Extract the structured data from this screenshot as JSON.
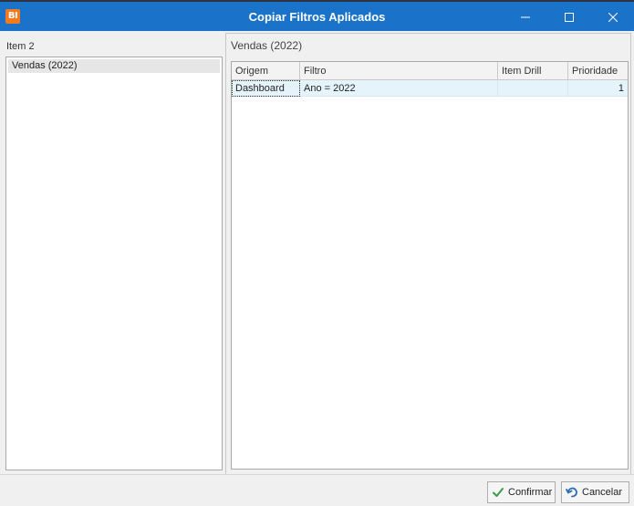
{
  "window": {
    "app_icon_text": "BI",
    "title": "Copiar Filtros Aplicados"
  },
  "left": {
    "label": "Item 2",
    "items": [
      {
        "label": "Vendas (2022)",
        "selected": true
      }
    ]
  },
  "right": {
    "title": "Vendas (2022)",
    "grid": {
      "columns": [
        "Origem",
        "Filtro",
        "Item Drill",
        "Prioridade"
      ],
      "rows": [
        {
          "origem": "Dashboard",
          "filtro": "Ano = 2022",
          "item_drill": "",
          "prioridade": "1"
        }
      ]
    }
  },
  "buttons": {
    "confirm_label": "Confirmar",
    "cancel_label": "Cancelar"
  },
  "colors": {
    "titlebar": "#1a73c9",
    "app_icon": "#f47a20",
    "row_selected": "#e5f3fb",
    "confirm_icon": "#3d9a4c",
    "cancel_icon": "#2a6db6"
  },
  "icons": {
    "app": "bi-logo-icon",
    "confirm": "checkmark-icon",
    "cancel": "undo-icon"
  }
}
